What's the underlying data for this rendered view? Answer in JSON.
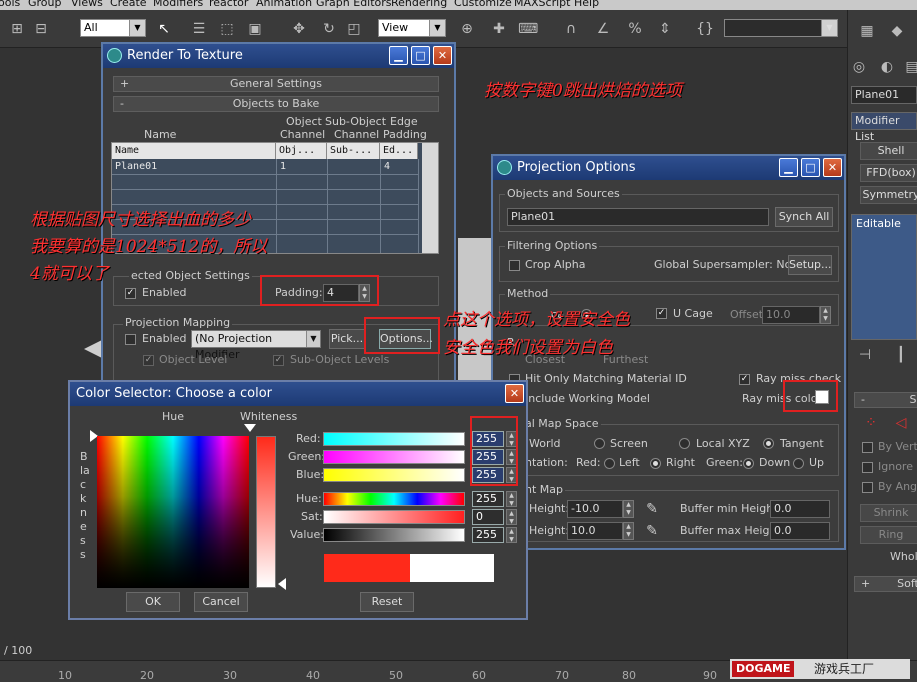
{
  "menubar": {
    "items": [
      "ools",
      "Group",
      "Views",
      "Create",
      "Modifiers",
      "reactor",
      "Animation",
      "Graph Editors",
      "Rendering",
      "Customize",
      "MAXScript",
      "Help"
    ]
  },
  "toolbar": {
    "selection_filter": "All",
    "ref_coord": "View",
    "icons": [
      "select-icon",
      "select-region-icon",
      "move-icon",
      "rotate-icon",
      "scale-icon",
      "snap-icon",
      "mirror-icon",
      "align-icon"
    ]
  },
  "command_panel": {
    "object_name": "Plane01",
    "modifier_list": "Modifier List",
    "buttons": [
      "Shell",
      "FFD(box)",
      "Symmetry"
    ],
    "stack_item": "Editable",
    "lower_items": [
      "By Verte",
      "Ignore B",
      "By Angle"
    ],
    "lower_buttons": [
      "Shrink",
      "Ring"
    ],
    "whole": "Whole",
    "soft": "Soft",
    "s_label": "S"
  },
  "annotations": {
    "press_zero": "按数字键0跳出烘焙的选项",
    "padding_line1": "根据贴图尺寸选择出血的多少",
    "padding_line2": "我要算的是1024*512的，所以",
    "padding_line3": "4就可以了",
    "options_line1": "点这个选项，设置安全色",
    "options_line2": "安全色我们设置为白色"
  },
  "rtt": {
    "title": "Render To Texture",
    "general_settings": "General Settings",
    "objects_to_bake": "Objects to Bake",
    "col_name": "Name",
    "col_object_channel": [
      "Object",
      "Channel"
    ],
    "col_subobject_channel": [
      "Sub-Object",
      "Channel"
    ],
    "col_edge_padding": [
      "Edge",
      "Padding"
    ],
    "table_headers": [
      "Name",
      "Obj...",
      "Sub-...",
      "Ed..."
    ],
    "table_rows": [
      {
        "name": "Plane01",
        "obj": "1",
        "sub": "",
        "ed": "4"
      }
    ],
    "selected_object_settings": "ected Object Settings",
    "enabled": "Enabled",
    "padding_label": "Padding:",
    "padding_value": "4",
    "projection_mapping": "Projection Mapping",
    "proj_enabled": "Enabled",
    "proj_modifier": "(No Projection Modifier",
    "pick": "Pick...",
    "options": "Options...",
    "object_level": "Object Level",
    "sub_object_levels": "Sub-Object Levels"
  },
  "po": {
    "title": "Projection Options",
    "objects_and_sources": "Objects and Sources",
    "object": "Plane01",
    "synch_all": "Synch All",
    "filtering_options": "Filtering Options",
    "crop_alpha": "Crop Alpha",
    "global_supersampler": "Global Supersampler: None",
    "setup": "Setup...",
    "method": "Method",
    "method_frag": "ce",
    "use_cage": "U  Cage",
    "offset_label": "Offset",
    "offset_value": "10.0",
    "resolve_frag": "R",
    "closest": "Closest",
    "furthest": "Furthest",
    "hit_only_matching": "Hit Only Matching Material ID",
    "ray_miss_check": "Ray miss check",
    "include_working_model": "Include Working Model",
    "ray_miss_color": "Ray miss color:",
    "normal_map_space": "al Map Space",
    "world": "World",
    "screen": "Screen",
    "local_xyz": "Local XYZ",
    "tangent": "Tangent",
    "orientation": "ntation:",
    "red": "Red:",
    "left": "Left",
    "right": "Right",
    "green": "Green:",
    "down": "Down",
    "up": "Up",
    "height_map": "ht Map",
    "height_min_label": "Height:",
    "height_min": "-10.0",
    "height_max_label": "Height:",
    "height_max": "10.0",
    "buffer_min_label": "Buffer min Height:",
    "buffer_min": "0.0",
    "buffer_max_label": "Buffer max Height:",
    "buffer_max": "0.0"
  },
  "cs": {
    "title": "Color Selector: Choose a color",
    "hue_label": "Hue",
    "whiteness_label": "Whiteness",
    "blackness_label": "Blackness",
    "red_label": "Red:",
    "green_label": "Green:",
    "blue_label": "Blue:",
    "hue2_label": "Hue:",
    "sat_label": "Sat:",
    "value_label": "Value:",
    "red": "255",
    "green": "255",
    "blue": "255",
    "hue": "255",
    "sat": "0",
    "value": "255",
    "ok": "OK",
    "cancel": "Cancel",
    "reset": "Reset"
  },
  "timeline": {
    "frame": "/ 100",
    "ticks": [
      "10",
      "20",
      "30",
      "40",
      "50",
      "60",
      "70",
      "80",
      "90"
    ],
    "watermark_brand": "DOGAME",
    "watermark_text": "游戏兵工厂"
  },
  "colors": {
    "title_bar": "#1d3a74",
    "highlight_box": "#e02020",
    "annotation": "#ff3030",
    "original_color": "#ff2a1a",
    "new_color": "#ffffff"
  }
}
